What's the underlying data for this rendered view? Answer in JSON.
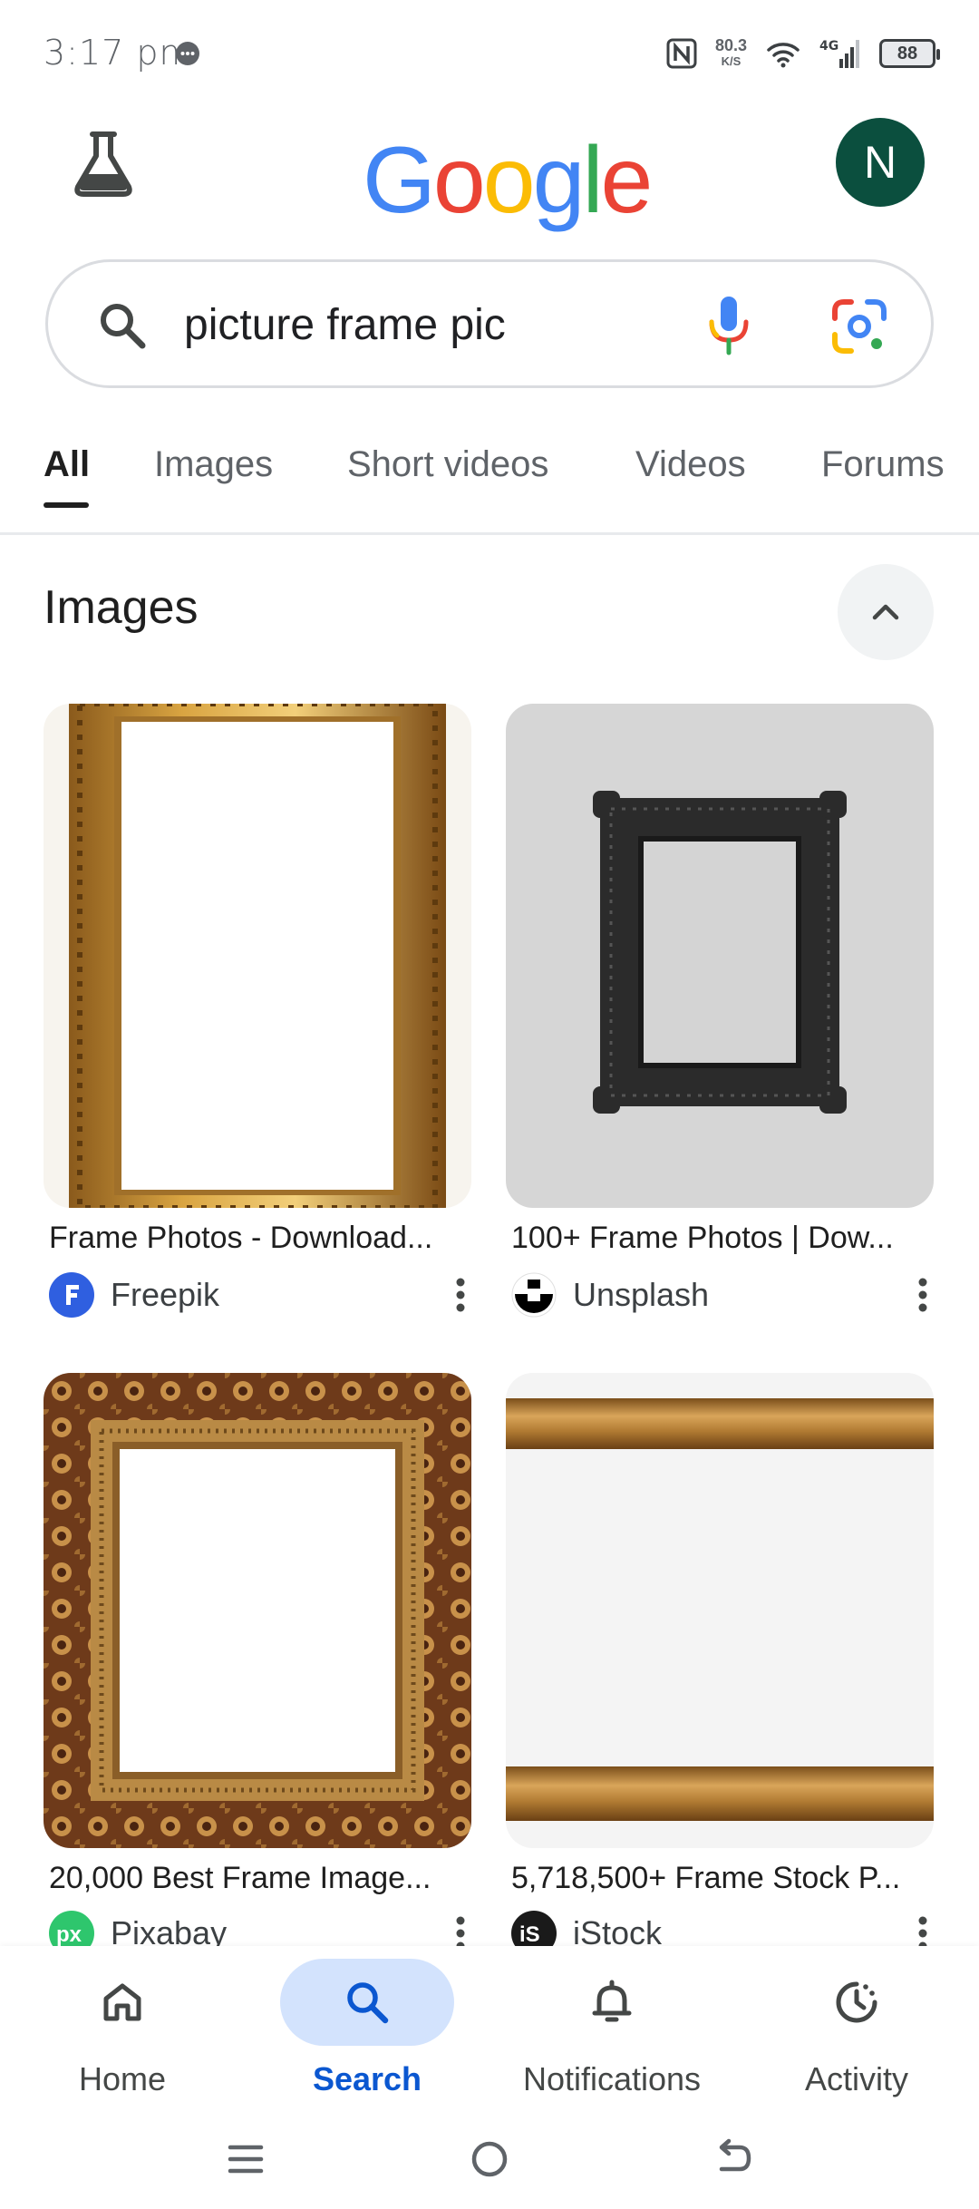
{
  "status_bar": {
    "time": "3:17 pm",
    "net_speed_value": "80.3",
    "net_speed_unit": "K/S",
    "network_type": "4G",
    "battery": "88"
  },
  "header": {
    "logo_letters": [
      "G",
      "o",
      "o",
      "g",
      "l",
      "e"
    ],
    "logo_colors": [
      "#4285F4",
      "#EA4335",
      "#FBBC05",
      "#4285F4",
      "#34A853",
      "#EA4335"
    ],
    "avatar_initial": "N",
    "avatar_color": "#0b4f3e"
  },
  "search": {
    "query": "picture frame pic"
  },
  "tabs": [
    {
      "label": "All",
      "active": true
    },
    {
      "label": "Images",
      "active": false
    },
    {
      "label": "Short videos",
      "active": false
    },
    {
      "label": "Videos",
      "active": false
    },
    {
      "label": "Forums",
      "active": false
    }
  ],
  "images_section": {
    "title": "Images",
    "results": [
      {
        "title": "Frame Photos - Download...",
        "source": "Freepik"
      },
      {
        "title": "100+ Frame Photos | Dow...",
        "source": "Unsplash"
      },
      {
        "title": "20,000 Best Frame Image...",
        "source": "Pixabay"
      },
      {
        "title": "5,718,500+ Frame Stock P...",
        "source": "iStock"
      }
    ]
  },
  "bottom_nav": [
    {
      "label": "Home",
      "icon": "home-icon",
      "active": false
    },
    {
      "label": "Search",
      "icon": "search-icon",
      "active": true
    },
    {
      "label": "Notifications",
      "icon": "bell-icon",
      "active": false
    },
    {
      "label": "Activity",
      "icon": "activity-icon",
      "active": false
    }
  ],
  "colors": {
    "accent": "#0b57d0",
    "active_pill": "#d3e3fd"
  }
}
